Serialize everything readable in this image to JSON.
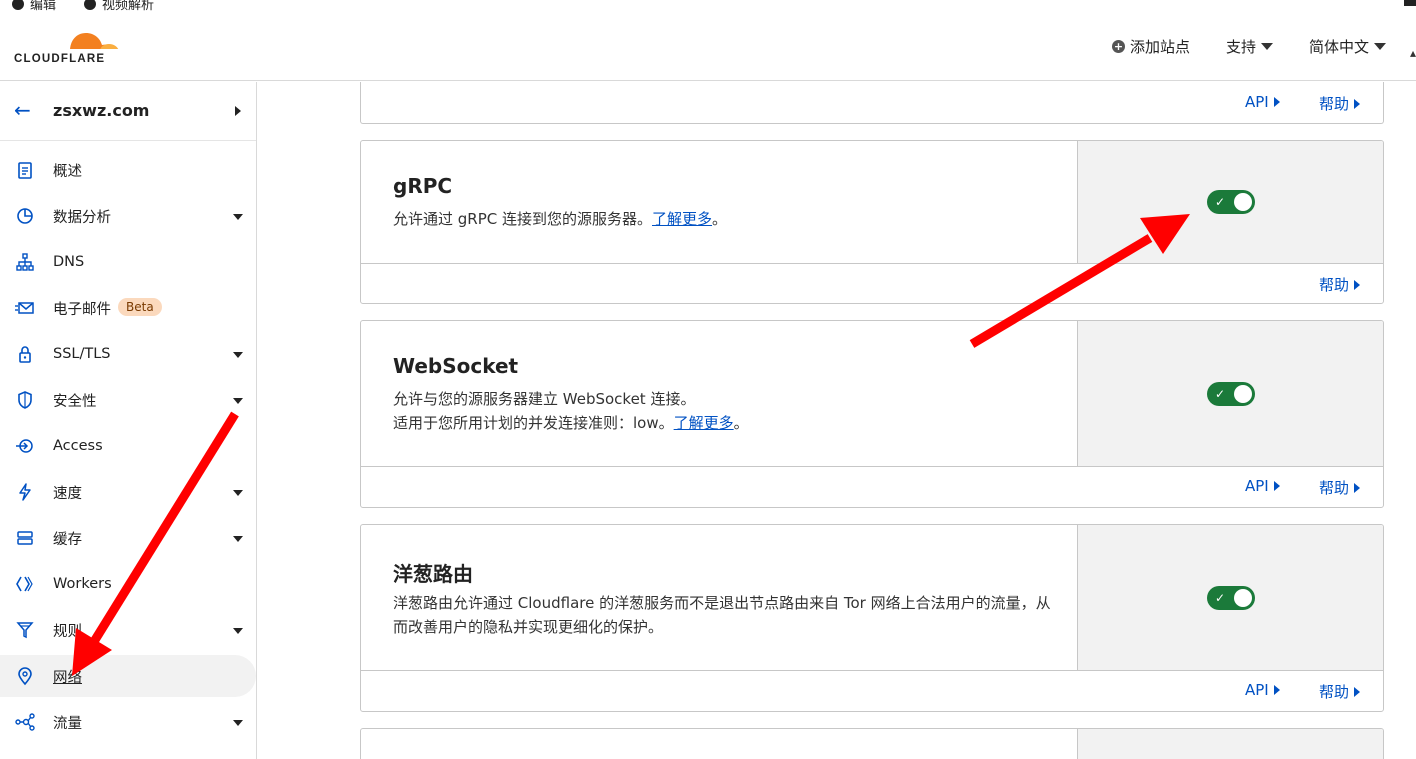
{
  "browser_bar": {
    "item1": "编辑",
    "item2": "视频解析"
  },
  "header": {
    "logo_text": "CLOUDFLARE",
    "add_site": "添加站点",
    "support": "支持",
    "language": "简体中文"
  },
  "sidebar": {
    "site_name": "zsxwz.com",
    "items": [
      {
        "label": "概述",
        "icon": "document-icon",
        "has_caret": false
      },
      {
        "label": "数据分析",
        "icon": "pie-chart-icon",
        "has_caret": true
      },
      {
        "label": "DNS",
        "icon": "network-tree-icon",
        "has_caret": false
      },
      {
        "label": "电子邮件",
        "icon": "email-icon",
        "has_caret": false,
        "badge": "Beta"
      },
      {
        "label": "SSL/TLS",
        "icon": "lock-icon",
        "has_caret": true
      },
      {
        "label": "安全性",
        "icon": "shield-icon",
        "has_caret": true
      },
      {
        "label": "Access",
        "icon": "access-icon",
        "has_caret": false
      },
      {
        "label": "速度",
        "icon": "lightning-icon",
        "has_caret": true
      },
      {
        "label": "缓存",
        "icon": "storage-icon",
        "has_caret": true
      },
      {
        "label": "Workers",
        "icon": "workers-icon",
        "has_caret": false
      },
      {
        "label": "规则",
        "icon": "funnel-icon",
        "has_caret": true
      },
      {
        "label": "网络",
        "icon": "location-pin-icon",
        "has_caret": false,
        "active": true
      },
      {
        "label": "流量",
        "icon": "traffic-icon",
        "has_caret": true
      }
    ]
  },
  "cards": {
    "top_partial": {
      "api_label": "API",
      "help_label": "帮助"
    },
    "grpc": {
      "title": "gRPC",
      "desc_before": "允许通过 gRPC 连接到您的源服务器。",
      "learn_more": "了解更多",
      "desc_after": "。",
      "enabled": true,
      "help_label": "帮助"
    },
    "websocket": {
      "title": "WebSocket",
      "desc_line1": "允许与您的源服务器建立 WebSocket 连接。",
      "desc_line2_before": "适用于您所用计划的并发连接准则：low。",
      "learn_more": "了解更多",
      "desc_after": "。",
      "enabled": true,
      "api_label": "API",
      "help_label": "帮助"
    },
    "onion": {
      "title": "洋葱路由",
      "desc": "洋葱路由允许通过 Cloudflare 的洋葱服务而不是退出节点路由来自 Tor 网络上合法用户的流量，从而改善用户的隐私并实现更细化的保护。",
      "enabled": true,
      "api_label": "API",
      "help_label": "帮助"
    }
  },
  "colors": {
    "accent_link": "#0051c3",
    "toggle_on": "#1b7a3a",
    "annotation_arrow": "#ff0000",
    "cloudflare_orange": "#f38020"
  }
}
